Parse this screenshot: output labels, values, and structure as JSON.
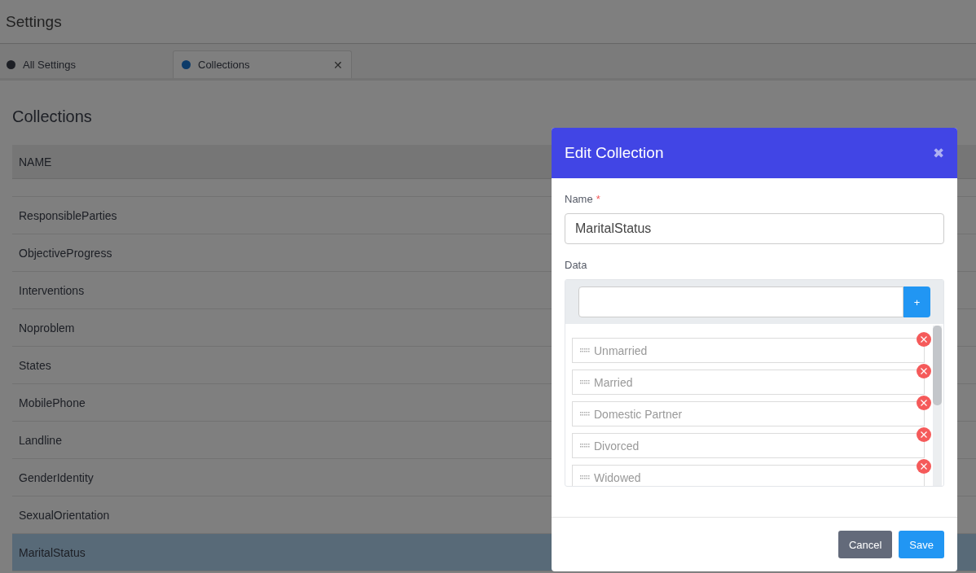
{
  "page_title": "Settings",
  "tabs": [
    {
      "label": "All Settings",
      "selected": false,
      "closable": false
    },
    {
      "label": "Collections",
      "selected": true,
      "closable": true
    }
  ],
  "close_tab_glyph": "✕",
  "section_title": "Collections",
  "table": {
    "columns": [
      "NAME"
    ],
    "rows": [
      {
        "name": "ResponsibleParties",
        "selected": false
      },
      {
        "name": "ObjectiveProgress",
        "selected": false
      },
      {
        "name": "Interventions",
        "selected": false
      },
      {
        "name": "Noproblem",
        "selected": false
      },
      {
        "name": "States",
        "selected": false
      },
      {
        "name": "MobilePhone",
        "selected": false
      },
      {
        "name": "Landline",
        "selected": false
      },
      {
        "name": "GenderIdentity",
        "selected": false
      },
      {
        "name": "SexualOrientation",
        "selected": false
      },
      {
        "name": "MaritalStatus",
        "selected": true
      }
    ]
  },
  "dialog": {
    "title": "Edit Collection",
    "close_glyph": "✖",
    "name_label": "Name",
    "required_mark": "*",
    "name_value": "MaritalStatus",
    "data_label": "Data",
    "add_glyph": "+",
    "items": [
      "Unmarried",
      "Married",
      "Domestic Partner",
      "Divorced",
      "Widowed"
    ],
    "buttons": [
      {
        "label": "Cancel",
        "kind": "secondary"
      },
      {
        "label": "Save",
        "kind": "primary"
      }
    ]
  }
}
